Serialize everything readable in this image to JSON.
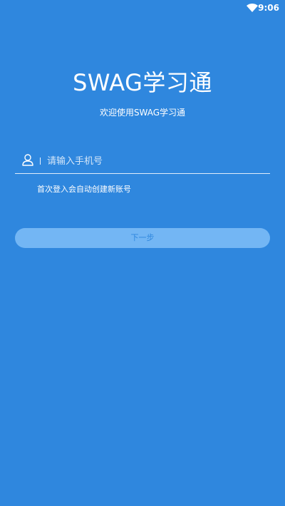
{
  "status_bar": {
    "time": "9:06",
    "icons": [
      "wifi-icon"
    ]
  },
  "app": {
    "title": "SWAG学习通",
    "subtitle": "欢迎使用SWAG学习通"
  },
  "login": {
    "phone_placeholder": "请输入手机号",
    "phone_value": "",
    "hint": "首次登入会自动创建新账号",
    "next_label": "下一步",
    "field_icon": "user-icon"
  },
  "colors": {
    "background": "#2f87de",
    "button": "#73b6f4",
    "text": "#ffffff"
  }
}
